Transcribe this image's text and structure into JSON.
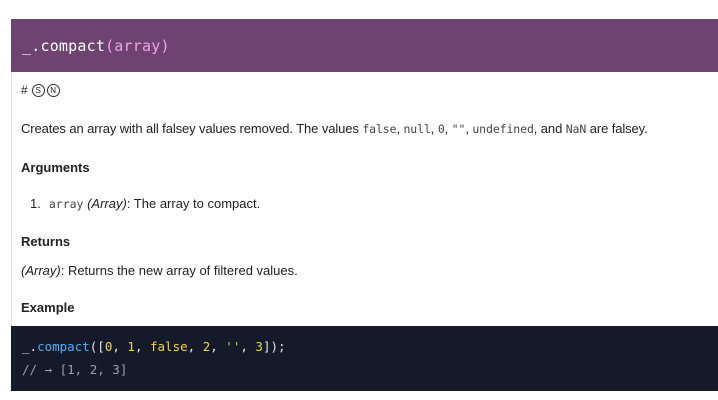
{
  "header": {
    "name": "_.compact",
    "params": "(array)"
  },
  "links": {
    "hash": "#",
    "source": "S",
    "npm": "N"
  },
  "description": {
    "part1": "Creates an array with all falsey values removed. The values ",
    "false": "false",
    "sep1": ", ",
    "null": "null",
    "sep2": ", ",
    "zero": "0",
    "sep3": ", ",
    "empty": "\"\"",
    "sep4": ", ",
    "undefined": "undefined",
    "sep5": ", and ",
    "nan": "NaN",
    "part2": " are falsey."
  },
  "arguments": {
    "heading": "Arguments",
    "items": [
      {
        "num": "1.",
        "name": "array",
        "type": "(Array)",
        "desc": ": The array to compact."
      }
    ]
  },
  "returns": {
    "heading": "Returns",
    "type": "(Array)",
    "desc": ": Returns the new array of filtered values."
  },
  "example": {
    "heading": "Example",
    "line1": {
      "obj": "_",
      "dot": ".",
      "fn": "compact",
      "open": "([",
      "v0": "0",
      "c1": ", ",
      "v1": "1",
      "c2": ", ",
      "v2": "false",
      "c3": ", ",
      "v3": "2",
      "c4": ", ",
      "v4": "''",
      "c5": ", ",
      "v5": "3",
      "close": "]);"
    },
    "line2": "// → [1, 2, 3]"
  },
  "colors": {
    "header_bg": "#6e4371",
    "header_params": "#f1a3e8",
    "code_bg": "#141a2a",
    "code_fn": "#4eaff4",
    "code_num": "#f0d24d",
    "code_str": "#a3e04a"
  }
}
